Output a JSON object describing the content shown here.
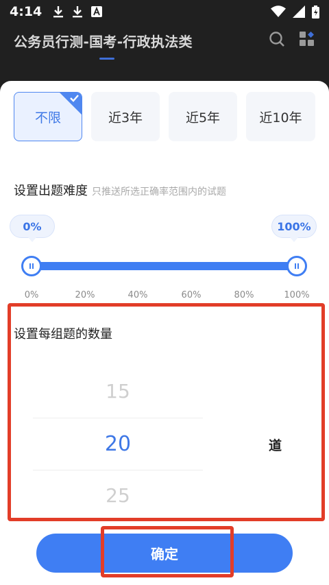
{
  "status_bar": {
    "time": "4:14",
    "notification_icons": [
      "download-icon",
      "download-icon",
      "app-a-icon"
    ],
    "system_icons": [
      "wifi-icon",
      "signal-icon",
      "battery-charging-icon"
    ]
  },
  "header": {
    "title": "公务员行测-国考-行政执法类",
    "icons": [
      "search-icon",
      "grid-menu-icon"
    ]
  },
  "year_filter": {
    "options": [
      {
        "label": "不限",
        "selected": true
      },
      {
        "label": "近3年",
        "selected": false
      },
      {
        "label": "近5年",
        "selected": false
      },
      {
        "label": "近10年",
        "selected": false
      }
    ]
  },
  "difficulty": {
    "title": "设置出题难度",
    "hint": "只推送所选正确率范围内的试题",
    "min_label": "0%",
    "max_label": "100%",
    "range": [
      0,
      100
    ],
    "ticks": [
      "0%",
      "20%",
      "40%",
      "60%",
      "80%",
      "100%"
    ]
  },
  "question_count": {
    "title": "设置每组题的数量",
    "options": [
      "15",
      "20",
      "25"
    ],
    "selected": "20",
    "unit": "道"
  },
  "confirm": {
    "label": "确定"
  },
  "colors": {
    "accent": "#3f7ef3",
    "annotation": "#e23d28",
    "chip_bg": "#f4f6fa"
  }
}
